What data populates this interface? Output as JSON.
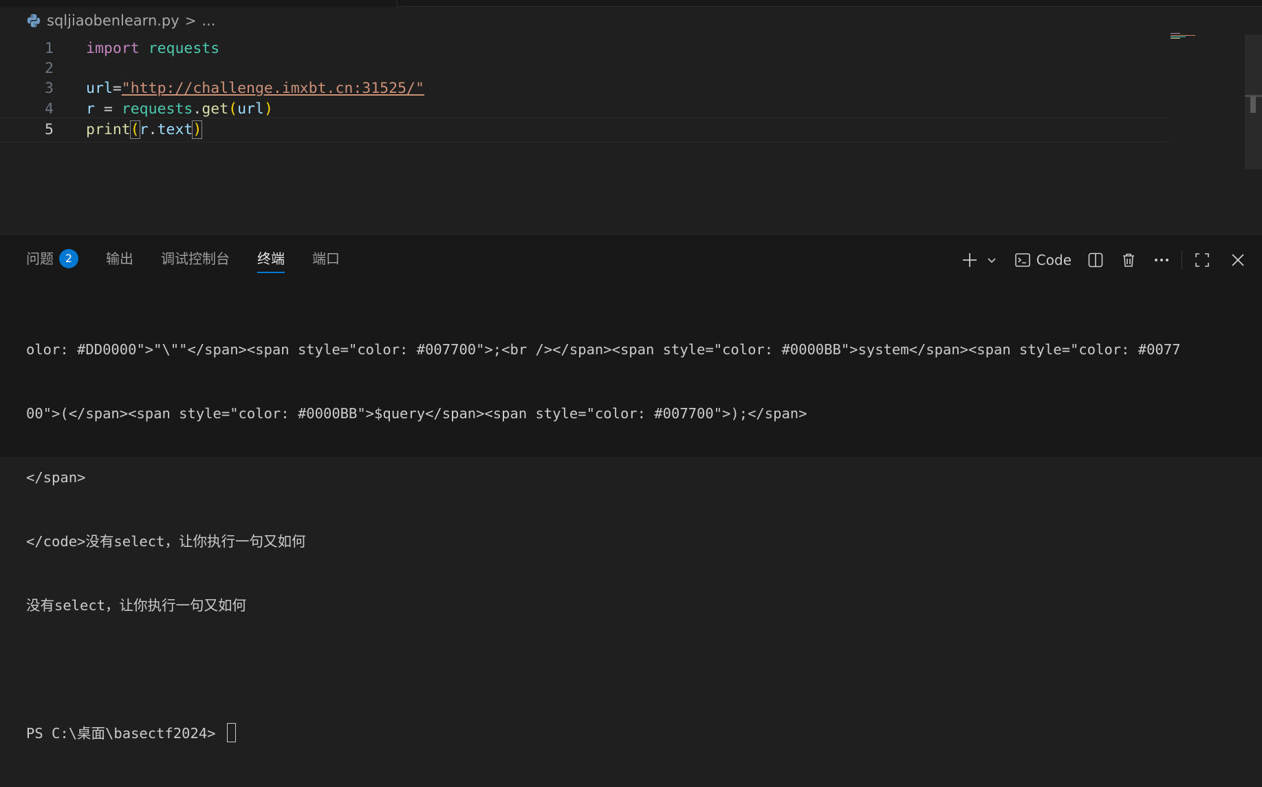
{
  "breadcrumb": {
    "file": "sqljiaobenlearn.py",
    "sep": ">",
    "more": "..."
  },
  "editor": {
    "lines": [
      {
        "n": "1",
        "tokens": [
          {
            "t": "import",
            "c": "kw"
          },
          {
            "t": " ",
            "c": "op"
          },
          {
            "t": "requests",
            "c": "mod"
          }
        ]
      },
      {
        "n": "2",
        "tokens": []
      },
      {
        "n": "3",
        "tokens": [
          {
            "t": "url",
            "c": "var"
          },
          {
            "t": "=",
            "c": "op"
          },
          {
            "t": "\"http://challenge.imxbt.cn:31525/\"",
            "c": "str url"
          }
        ]
      },
      {
        "n": "4",
        "tokens": [
          {
            "t": "r",
            "c": "var"
          },
          {
            "t": " = ",
            "c": "op"
          },
          {
            "t": "requests",
            "c": "mod"
          },
          {
            "t": ".",
            "c": "op"
          },
          {
            "t": "get",
            "c": "fn"
          },
          {
            "t": "(",
            "c": "br1"
          },
          {
            "t": "url",
            "c": "var"
          },
          {
            "t": ")",
            "c": "br1"
          }
        ]
      },
      {
        "n": "5",
        "tokens": [
          {
            "t": "print",
            "c": "fn"
          },
          {
            "t": "(",
            "c": "br1 br-hl"
          },
          {
            "t": "r",
            "c": "var"
          },
          {
            "t": ".",
            "c": "op"
          },
          {
            "t": "text",
            "c": "var"
          },
          {
            "t": ")",
            "c": "br1 br-hl"
          }
        ]
      }
    ],
    "active_line": "5"
  },
  "panel": {
    "tabs": [
      {
        "label": "问题",
        "badge": "2",
        "active": false
      },
      {
        "label": "输出",
        "active": false
      },
      {
        "label": "调试控制台",
        "active": false
      },
      {
        "label": "终端",
        "active": true
      },
      {
        "label": "端口",
        "active": false
      }
    ],
    "actions": {
      "new_terminal_icon": "plus-icon",
      "dropdown_icon": "chevron-down-icon",
      "profile_icon": "terminal-icon",
      "profile_label": "Code",
      "split_icon": "split-icon",
      "trash_icon": "trash-icon",
      "more_icon": "ellipsis-icon",
      "maximize_icon": "maximize-icon",
      "close_icon": "close-icon"
    }
  },
  "terminal": {
    "lines": [
      "olor: #DD0000\">\"\\\"\"</span><span style=\"color: #007700\">;<br /></span><span style=\"color: #0000BB\">system</span><span style=\"color: #0077",
      "00\">(</span><span style=\"color: #0000BB\">$query</span><span style=\"color: #007700\">);</span>",
      "</span>",
      "</code>没有select，让你执行一句又如何",
      "没有select，让你执行一句又如何",
      "",
      "PS C:\\桌面\\basectf2024> "
    ]
  },
  "colors": {
    "accent": "#0078d4",
    "editor_bg": "#1f1f1f",
    "panel_bg": "#181818"
  }
}
